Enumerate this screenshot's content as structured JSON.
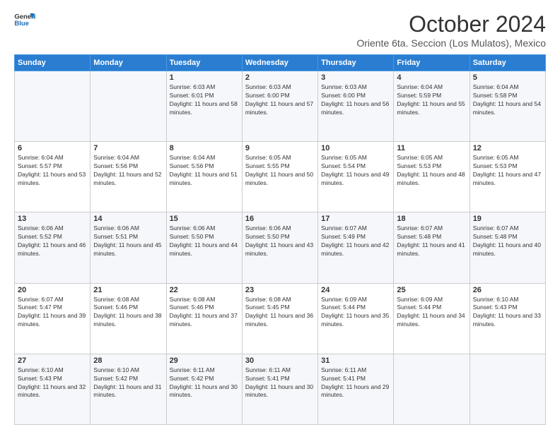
{
  "header": {
    "logo_general": "General",
    "logo_blue": "Blue",
    "title": "October 2024",
    "subtitle": "Oriente 6ta. Seccion (Los Mulatos), Mexico"
  },
  "columns": [
    "Sunday",
    "Monday",
    "Tuesday",
    "Wednesday",
    "Thursday",
    "Friday",
    "Saturday"
  ],
  "weeks": [
    [
      {
        "day": "",
        "sunrise": "",
        "sunset": "",
        "daylight": ""
      },
      {
        "day": "",
        "sunrise": "",
        "sunset": "",
        "daylight": ""
      },
      {
        "day": "1",
        "sunrise": "Sunrise: 6:03 AM",
        "sunset": "Sunset: 6:01 PM",
        "daylight": "Daylight: 11 hours and 58 minutes."
      },
      {
        "day": "2",
        "sunrise": "Sunrise: 6:03 AM",
        "sunset": "Sunset: 6:00 PM",
        "daylight": "Daylight: 11 hours and 57 minutes."
      },
      {
        "day": "3",
        "sunrise": "Sunrise: 6:03 AM",
        "sunset": "Sunset: 6:00 PM",
        "daylight": "Daylight: 11 hours and 56 minutes."
      },
      {
        "day": "4",
        "sunrise": "Sunrise: 6:04 AM",
        "sunset": "Sunset: 5:59 PM",
        "daylight": "Daylight: 11 hours and 55 minutes."
      },
      {
        "day": "5",
        "sunrise": "Sunrise: 6:04 AM",
        "sunset": "Sunset: 5:58 PM",
        "daylight": "Daylight: 11 hours and 54 minutes."
      }
    ],
    [
      {
        "day": "6",
        "sunrise": "Sunrise: 6:04 AM",
        "sunset": "Sunset: 5:57 PM",
        "daylight": "Daylight: 11 hours and 53 minutes."
      },
      {
        "day": "7",
        "sunrise": "Sunrise: 6:04 AM",
        "sunset": "Sunset: 5:56 PM",
        "daylight": "Daylight: 11 hours and 52 minutes."
      },
      {
        "day": "8",
        "sunrise": "Sunrise: 6:04 AM",
        "sunset": "Sunset: 5:56 PM",
        "daylight": "Daylight: 11 hours and 51 minutes."
      },
      {
        "day": "9",
        "sunrise": "Sunrise: 6:05 AM",
        "sunset": "Sunset: 5:55 PM",
        "daylight": "Daylight: 11 hours and 50 minutes."
      },
      {
        "day": "10",
        "sunrise": "Sunrise: 6:05 AM",
        "sunset": "Sunset: 5:54 PM",
        "daylight": "Daylight: 11 hours and 49 minutes."
      },
      {
        "day": "11",
        "sunrise": "Sunrise: 6:05 AM",
        "sunset": "Sunset: 5:53 PM",
        "daylight": "Daylight: 11 hours and 48 minutes."
      },
      {
        "day": "12",
        "sunrise": "Sunrise: 6:05 AM",
        "sunset": "Sunset: 5:53 PM",
        "daylight": "Daylight: 11 hours and 47 minutes."
      }
    ],
    [
      {
        "day": "13",
        "sunrise": "Sunrise: 6:06 AM",
        "sunset": "Sunset: 5:52 PM",
        "daylight": "Daylight: 11 hours and 46 minutes."
      },
      {
        "day": "14",
        "sunrise": "Sunrise: 6:06 AM",
        "sunset": "Sunset: 5:51 PM",
        "daylight": "Daylight: 11 hours and 45 minutes."
      },
      {
        "day": "15",
        "sunrise": "Sunrise: 6:06 AM",
        "sunset": "Sunset: 5:50 PM",
        "daylight": "Daylight: 11 hours and 44 minutes."
      },
      {
        "day": "16",
        "sunrise": "Sunrise: 6:06 AM",
        "sunset": "Sunset: 5:50 PM",
        "daylight": "Daylight: 11 hours and 43 minutes."
      },
      {
        "day": "17",
        "sunrise": "Sunrise: 6:07 AM",
        "sunset": "Sunset: 5:49 PM",
        "daylight": "Daylight: 11 hours and 42 minutes."
      },
      {
        "day": "18",
        "sunrise": "Sunrise: 6:07 AM",
        "sunset": "Sunset: 5:48 PM",
        "daylight": "Daylight: 11 hours and 41 minutes."
      },
      {
        "day": "19",
        "sunrise": "Sunrise: 6:07 AM",
        "sunset": "Sunset: 5:48 PM",
        "daylight": "Daylight: 11 hours and 40 minutes."
      }
    ],
    [
      {
        "day": "20",
        "sunrise": "Sunrise: 6:07 AM",
        "sunset": "Sunset: 5:47 PM",
        "daylight": "Daylight: 11 hours and 39 minutes."
      },
      {
        "day": "21",
        "sunrise": "Sunrise: 6:08 AM",
        "sunset": "Sunset: 5:46 PM",
        "daylight": "Daylight: 11 hours and 38 minutes."
      },
      {
        "day": "22",
        "sunrise": "Sunrise: 6:08 AM",
        "sunset": "Sunset: 5:46 PM",
        "daylight": "Daylight: 11 hours and 37 minutes."
      },
      {
        "day": "23",
        "sunrise": "Sunrise: 6:08 AM",
        "sunset": "Sunset: 5:45 PM",
        "daylight": "Daylight: 11 hours and 36 minutes."
      },
      {
        "day": "24",
        "sunrise": "Sunrise: 6:09 AM",
        "sunset": "Sunset: 5:44 PM",
        "daylight": "Daylight: 11 hours and 35 minutes."
      },
      {
        "day": "25",
        "sunrise": "Sunrise: 6:09 AM",
        "sunset": "Sunset: 5:44 PM",
        "daylight": "Daylight: 11 hours and 34 minutes."
      },
      {
        "day": "26",
        "sunrise": "Sunrise: 6:10 AM",
        "sunset": "Sunset: 5:43 PM",
        "daylight": "Daylight: 11 hours and 33 minutes."
      }
    ],
    [
      {
        "day": "27",
        "sunrise": "Sunrise: 6:10 AM",
        "sunset": "Sunset: 5:43 PM",
        "daylight": "Daylight: 11 hours and 32 minutes."
      },
      {
        "day": "28",
        "sunrise": "Sunrise: 6:10 AM",
        "sunset": "Sunset: 5:42 PM",
        "daylight": "Daylight: 11 hours and 31 minutes."
      },
      {
        "day": "29",
        "sunrise": "Sunrise: 6:11 AM",
        "sunset": "Sunset: 5:42 PM",
        "daylight": "Daylight: 11 hours and 30 minutes."
      },
      {
        "day": "30",
        "sunrise": "Sunrise: 6:11 AM",
        "sunset": "Sunset: 5:41 PM",
        "daylight": "Daylight: 11 hours and 30 minutes."
      },
      {
        "day": "31",
        "sunrise": "Sunrise: 6:11 AM",
        "sunset": "Sunset: 5:41 PM",
        "daylight": "Daylight: 11 hours and 29 minutes."
      },
      {
        "day": "",
        "sunrise": "",
        "sunset": "",
        "daylight": ""
      },
      {
        "day": "",
        "sunrise": "",
        "sunset": "",
        "daylight": ""
      }
    ]
  ]
}
